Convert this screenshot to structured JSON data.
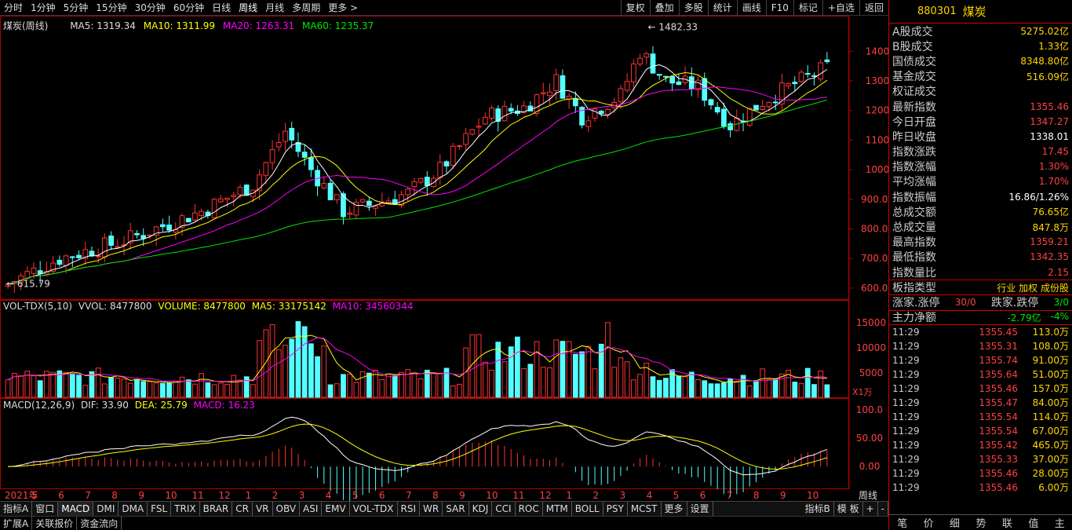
{
  "timeframes": [
    "分时",
    "1分钟",
    "5分钟",
    "15分钟",
    "30分钟",
    "60分钟",
    "日线",
    "周线",
    "月线",
    "多周期",
    "更多 >"
  ],
  "active_tf": "周线",
  "tools": [
    "复权",
    "叠加",
    "多股",
    "统计",
    "画线",
    "F10",
    "标记",
    "+自选",
    "返回"
  ],
  "main": {
    "title": "煤炭(周线)",
    "ma5": "MA5: 1319.34",
    "ma10": "MA10: 1311.99",
    "ma20": "MA20: 1263.31",
    "ma60": "MA60: 1235.37",
    "hi_label": "1482.33",
    "lo_label": "615.79",
    "yticks": [
      "1400",
      "1300",
      "1200",
      "1100",
      "1000",
      "900.00",
      "800.00",
      "700.00",
      "600.00"
    ]
  },
  "vol": {
    "title": "VOL-TDX(5,10)",
    "vvol": "VVOL: 8477800",
    "volume": "VOLUME: 8477800",
    "ma5": "MA5: 33175142",
    "ma10": "MA10: 34560344",
    "yticks": [
      "15000",
      "10000",
      "5000"
    ],
    "unit": "X1万"
  },
  "macd": {
    "title": "MACD(12,26,9)",
    "dif": "DIF: 33.90",
    "dea": "DEA: 25.79",
    "macd": "MACD: 16.23",
    "yticks": [
      "100.0",
      "50.00",
      "0.00"
    ]
  },
  "xaxis": [
    "2021年",
    "5",
    "6",
    "7",
    "8",
    "9",
    "10",
    "11",
    "12",
    "1",
    "2",
    "3",
    "4",
    "5",
    "6",
    "7",
    "8",
    "9",
    "10",
    "11",
    "12",
    "1",
    "2",
    "3",
    "4",
    "5",
    "6",
    "7",
    "8",
    "9",
    "10"
  ],
  "period_label": "周线",
  "colors": {
    "up": "#ff3232",
    "down": "#54ffff",
    "ma5": "#ffffff",
    "ma10": "#ffff00",
    "ma20": "#ff00ff",
    "ma60": "#00e600"
  },
  "bottom_tabs": [
    "指标A",
    "窗口",
    "MACD",
    "DMI",
    "DMA",
    "FSL",
    "TRIX",
    "BRAR",
    "CR",
    "VR",
    "OBV",
    "ASI",
    "EMV",
    "VOL-TDX",
    "RSI",
    "WR",
    "SAR",
    "KDJ",
    "CCI",
    "ROC",
    "MTM",
    "BOLL",
    "PSY",
    "MCST",
    "更多",
    "设置"
  ],
  "bottom_right": [
    "指标B",
    "模 板",
    "+",
    "-"
  ],
  "bottom2": [
    "扩展A",
    "关联报价",
    "资金流向"
  ],
  "side": {
    "code": "880301",
    "name": "煤炭",
    "rows": [
      {
        "label": "A股成交",
        "value": "5275.02亿",
        "color": "#ffd700"
      },
      {
        "label": "B股成交",
        "value": "1.33亿",
        "color": "#ffd700"
      },
      {
        "label": "国债成交",
        "value": "8348.80亿",
        "color": "#ffd700"
      },
      {
        "label": "基金成交",
        "value": "516.09亿",
        "color": "#ffd700"
      },
      {
        "label": "权证成交",
        "value": "",
        "color": "#ffd700"
      },
      {
        "label": "最新指数",
        "value": "1355.46",
        "color": "#ff4040"
      },
      {
        "label": "今日开盘",
        "value": "1347.27",
        "color": "#ff4040"
      },
      {
        "label": "昨日收盘",
        "value": "1338.01",
        "color": "#ffffff"
      },
      {
        "label": "指数涨跌",
        "value": "17.45",
        "color": "#ff4040"
      },
      {
        "label": "指数涨幅",
        "value": "1.30%",
        "color": "#ff4040"
      },
      {
        "label": "平均涨幅",
        "value": "1.70%",
        "color": "#ff4040"
      },
      {
        "label": "指数振幅",
        "value": "16.86/1.26%",
        "color": "#ffffff"
      },
      {
        "label": "总成交额",
        "value": "76.65亿",
        "color": "#ffd700"
      },
      {
        "label": "总成交量",
        "value": "847.8万",
        "color": "#ffd700"
      },
      {
        "label": "最高指数",
        "value": "1359.21",
        "color": "#ff4040"
      },
      {
        "label": "最低指数",
        "value": "1342.35",
        "color": "#ff4040"
      },
      {
        "label": "指数量比",
        "value": "2.15",
        "color": "#ff4040"
      }
    ],
    "type_label": "板指类型",
    "type_value": "行业 加权 成份股",
    "updown_label": "涨家.涨停",
    "updown_value": "30/0",
    "down_label": "跌家.跌停",
    "down_value": "3/0",
    "flow_label": "主力净额",
    "flow_value": "-2.79亿",
    "flow_pct": "-4%",
    "ticks": [
      [
        "11:29",
        "1355.45",
        "113.0万"
      ],
      [
        "11:29",
        "1355.31",
        "108.0万"
      ],
      [
        "11:29",
        "1355.74",
        "91.00万"
      ],
      [
        "11:29",
        "1355.64",
        "51.00万"
      ],
      [
        "11:29",
        "1355.46",
        "157.0万"
      ],
      [
        "11:29",
        "1355.47",
        "84.00万"
      ],
      [
        "11:29",
        "1355.54",
        "114.0万"
      ],
      [
        "11:29",
        "1355.54",
        "67.00万"
      ],
      [
        "11:29",
        "1355.42",
        "465.0万"
      ],
      [
        "11:29",
        "1355.33",
        "37.00万"
      ],
      [
        "11:29",
        "1355.46",
        "28.00万"
      ],
      [
        "11:29",
        "1355.46",
        "6.00万"
      ]
    ],
    "foot": [
      "笔",
      "价",
      "细",
      "势",
      "联",
      "值",
      "主"
    ]
  }
}
